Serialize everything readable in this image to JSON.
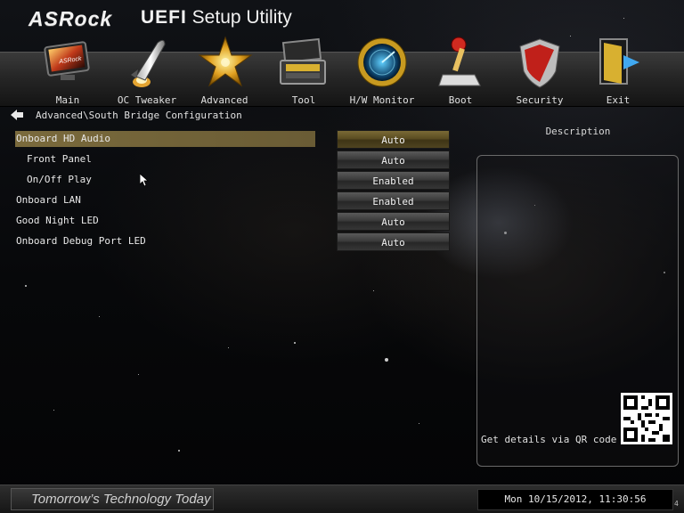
{
  "header": {
    "brand": "ASRock",
    "product_bold": "UEFI",
    "product_rest": " Setup Utility"
  },
  "nav": {
    "items": [
      {
        "label": "Main",
        "icon": "monitor-icon"
      },
      {
        "label": "OC Tweaker",
        "icon": "rocket-icon"
      },
      {
        "label": "Advanced",
        "icon": "star-icon"
      },
      {
        "label": "Tool",
        "icon": "toolbox-icon"
      },
      {
        "label": "H/W Monitor",
        "icon": "radar-icon"
      },
      {
        "label": "Boot",
        "icon": "joystick-icon"
      },
      {
        "label": "Security",
        "icon": "shield-icon"
      },
      {
        "label": "Exit",
        "icon": "exit-door-icon"
      }
    ]
  },
  "breadcrumb": {
    "text": "Advanced\\South Bridge Configuration",
    "back_icon": "back-arrow-icon"
  },
  "settings": [
    {
      "label": "Onboard HD Audio",
      "value": "Auto",
      "selected": true
    },
    {
      "label": "Front Panel",
      "value": "Auto"
    },
    {
      "label": "On/Off Play",
      "value": "Enabled"
    },
    {
      "label": "Onboard LAN",
      "value": "Enabled"
    },
    {
      "label": "Good Night LED",
      "value": "Auto"
    },
    {
      "label": "Onboard Debug Port LED",
      "value": "Auto"
    }
  ],
  "description": {
    "title": "Description",
    "qr_text": "Get details via QR code"
  },
  "footer": {
    "slogan": "Tomorrow’s Technology Today",
    "datetime": "Mon 10/15/2012, 11:30:56",
    "corner_text": "4"
  },
  "colors": {
    "selected_gold": "#7a6a3c",
    "bar_gray": "#3b3b3b"
  }
}
